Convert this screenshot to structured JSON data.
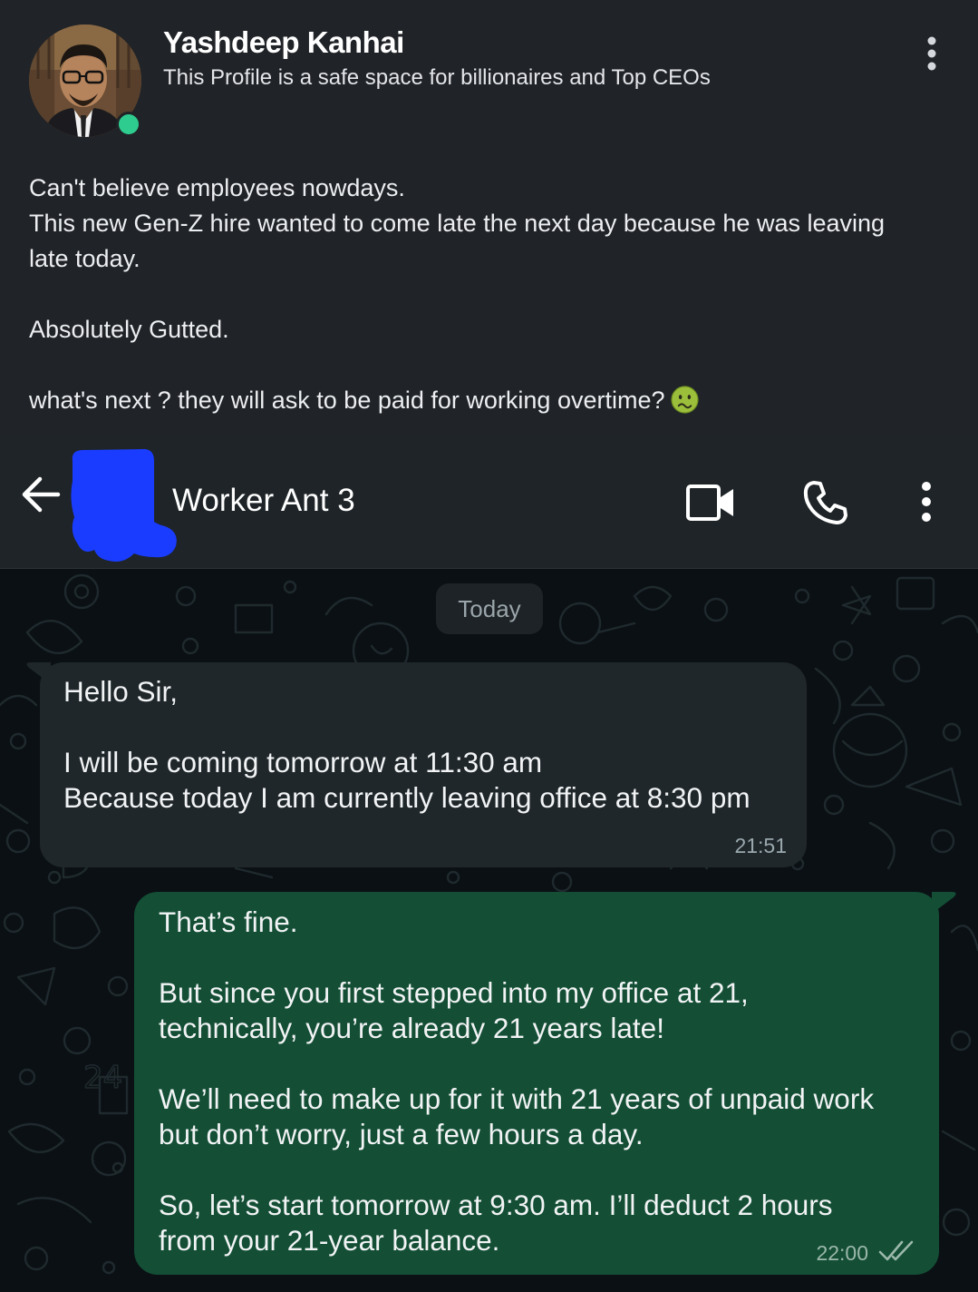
{
  "post": {
    "author_name": "Yashdeep Kanhai",
    "tagline": "This Profile is a safe space for billionaires and Top CEOs",
    "body": {
      "line1": "Can't believe employees nowdays.",
      "line2": "This new Gen-Z hire wanted to come late the next day because he was leaving",
      "line3": "late today.",
      "line4": "Absolutely Gutted.",
      "line5": "what's next ? they will ask to be paid for working overtime?"
    },
    "emoji": "nauseated-face-emoji",
    "menu_icon": "more-vertical-icon",
    "online_status_color": "#2ecc8f"
  },
  "chat_header": {
    "contact_name": "Worker Ant 3",
    "back_icon": "arrow-left-icon",
    "video_icon": "video-call-icon",
    "call_icon": "phone-icon",
    "menu_icon": "more-vertical-icon"
  },
  "chat": {
    "date_separator": "Today",
    "messages": [
      {
        "direction": "incoming",
        "lines": [
          "Hello Sir,",
          "I will be coming tomorrow at 11:30 am",
          "Because today I am currently leaving office at 8:30 pm"
        ],
        "time": "21:51"
      },
      {
        "direction": "outgoing",
        "lines": [
          "That’s fine.",
          "But since you first stepped into my office at 21,",
          "technically, you’re already 21 years late!",
          "We’ll need to make up for it with 21 years of unpaid work",
          "but don’t worry, just a few hours a day.",
          "So, let’s start tomorrow at 9:30 am. I’ll deduct 2 hours",
          "from your 21-year balance."
        ],
        "time": "22:00",
        "status_icon": "double-check-icon"
      }
    ]
  },
  "colors": {
    "post_bg": "#202327",
    "header_bg": "#1e2427",
    "chat_bg": "#0b1014",
    "incoming_bubble": "#1f272b",
    "outgoing_bubble": "#134e35",
    "redaction_blue": "#1a3cff"
  }
}
